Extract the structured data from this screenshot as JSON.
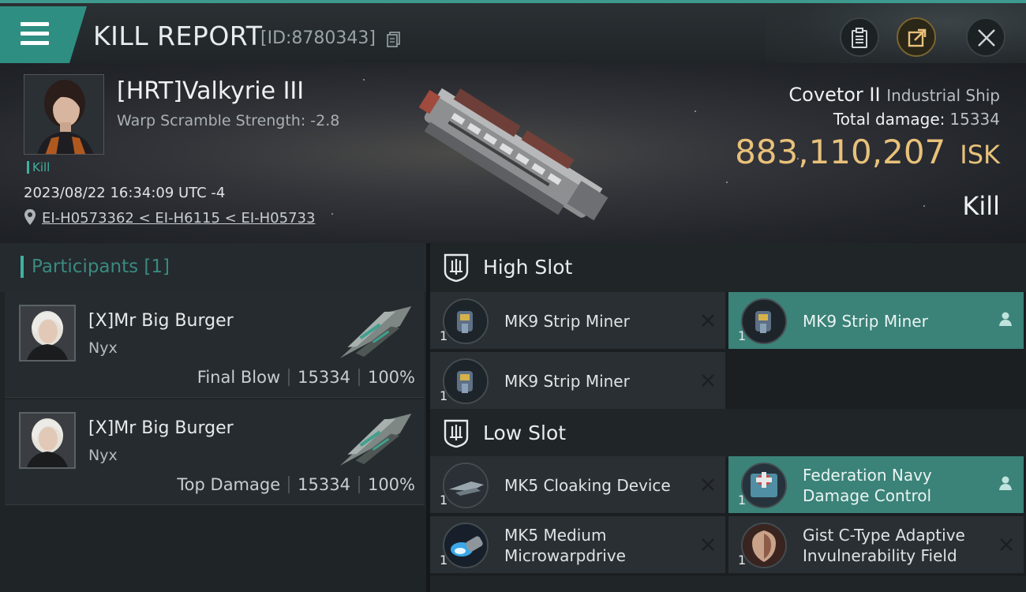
{
  "header": {
    "title": "KILL REPORT",
    "report_id": "[ID:8780343]"
  },
  "victim": {
    "name": "[HRT]Valkyrie III",
    "warp_scramble": "Warp Scramble Strength: -2.8",
    "tag": "Kill",
    "datetime": "2023/08/22 16:34:09 UTC -4",
    "location": "EI-H0573362 < EI-H6115 < EI-H05733",
    "ship_name": "Covetor II",
    "ship_class": "Industrial Ship",
    "total_damage_label": "Total damage:",
    "total_damage": "15334",
    "isk_value": "883,110,207",
    "isk_unit": "ISK",
    "result": "Kill"
  },
  "participants": {
    "title": "Participants [1]",
    "rows": [
      {
        "name": "[X]Mr Big Burger",
        "ship": "Nyx",
        "role": "Final Blow",
        "damage": "15334",
        "percent": "100%"
      },
      {
        "name": "[X]Mr Big Burger",
        "ship": "Nyx",
        "role": "Top Damage",
        "damage": "15334",
        "percent": "100%"
      }
    ]
  },
  "slots": {
    "high": {
      "title": "High Slot",
      "modules": [
        {
          "name": "MK9 Strip Miner",
          "qty": "1",
          "fitted": false,
          "icon": "strip-miner-icon"
        },
        {
          "name": "MK9 Strip Miner",
          "qty": "1",
          "fitted": true,
          "icon": "strip-miner-icon"
        },
        {
          "name": "MK9 Strip Miner",
          "qty": "1",
          "fitted": false,
          "icon": "strip-miner-icon"
        }
      ]
    },
    "low": {
      "title": "Low Slot",
      "modules": [
        {
          "name": "MK5 Cloaking Device",
          "qty": "1",
          "fitted": false,
          "icon": "cloaking-device-icon"
        },
        {
          "name_line1": "Federation Navy",
          "name_line2": "Damage Control",
          "qty": "1",
          "fitted": true,
          "icon": "damage-control-icon"
        },
        {
          "name_line1": "MK5 Medium",
          "name_line2": "Microwarpdrive",
          "qty": "1",
          "fitted": false,
          "icon": "microwarpdrive-icon"
        },
        {
          "name_line1": "Gist C-Type Adaptive",
          "name_line2": "Invulnerability Field",
          "qty": "1",
          "fitted": false,
          "icon": "invulnerability-field-icon"
        }
      ]
    }
  },
  "colors": {
    "accent": "#3fb0a2",
    "isk": "#e8c17a",
    "fitted_bg": "#3b8278"
  }
}
